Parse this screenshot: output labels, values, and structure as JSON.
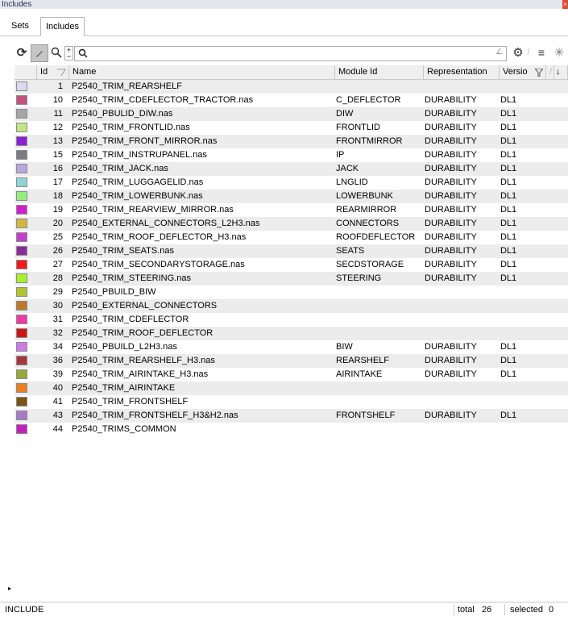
{
  "window": {
    "title": "Includes",
    "close_glyph": "×"
  },
  "tabs": [
    {
      "label": "Sets"
    },
    {
      "label": "Includes"
    }
  ],
  "toolbar": {
    "refresh_icon": "refresh-icon",
    "edit_icon": "pencil-icon",
    "zoom_icon": "zoom-icon",
    "search": {
      "value": "",
      "icon": "search-icon"
    },
    "settings_icon": "gear-icon",
    "menu_icon": "menu-icon",
    "filter_icon": "asterisk-icon"
  },
  "columns": {
    "id": "Id",
    "name": "Name",
    "module_id": "Module Id",
    "representation": "Representation",
    "version": "Versio"
  },
  "rows": [
    {
      "color": "#d9d9f2",
      "id": "1",
      "name": "P2540_TRIM_REARSHELF",
      "module": "",
      "rep": "",
      "ver": ""
    },
    {
      "color": "#c2547c",
      "id": "10",
      "name": "P2540_TRIM_CDEFLECTOR_TRACTOR.nas",
      "module": "C_DEFLECTOR",
      "rep": "DURABILITY",
      "ver": "DL1"
    },
    {
      "color": "#a5a5a5",
      "id": "11",
      "name": "P2540_PBULID_DIW.nas",
      "module": "DIW",
      "rep": "DURABILITY",
      "ver": "DL1"
    },
    {
      "color": "#c3e685",
      "id": "12",
      "name": "P2540_TRIM_FRONTLID.nas",
      "module": "FRONTLID",
      "rep": "DURABILITY",
      "ver": "DL1"
    },
    {
      "color": "#8a1fd6",
      "id": "13",
      "name": "P2540_TRIM_FRONT_MIRROR.nas",
      "module": "FRONTMIRROR",
      "rep": "DURABILITY",
      "ver": "DL1"
    },
    {
      "color": "#7b7b83",
      "id": "15",
      "name": "P2540_TRIM_INSTRUPANEL.nas",
      "module": "IP",
      "rep": "DURABILITY",
      "ver": "DL1"
    },
    {
      "color": "#b7a7dc",
      "id": "16",
      "name": "P2540_TRIM_JACK.nas",
      "module": "JACK",
      "rep": "DURABILITY",
      "ver": "DL1"
    },
    {
      "color": "#8fd4d6",
      "id": "17",
      "name": "P2540_TRIM_LUGGAGELID.nas",
      "module": "LNGLID",
      "rep": "DURABILITY",
      "ver": "DL1"
    },
    {
      "color": "#93ee7d",
      "id": "18",
      "name": "P2540_TRIM_LOWERBUNK.nas",
      "module": "LOWERBUNK",
      "rep": "DURABILITY",
      "ver": "DL1"
    },
    {
      "color": "#d11fcb",
      "id": "19",
      "name": "P2540_TRIM_REARVIEW_MIRROR.nas",
      "module": "REARMIRROR",
      "rep": "DURABILITY",
      "ver": "DL1"
    },
    {
      "color": "#d3b83f",
      "id": "20",
      "name": "P2540_EXTERNAL_CONNECTORS_L2H3.nas",
      "module": "CONNECTORS",
      "rep": "DURABILITY",
      "ver": "DL1"
    },
    {
      "color": "#c23fcf",
      "id": "25",
      "name": "P2540_TRIM_ROOF_DEFLECTOR_H3.nas",
      "module": "ROOFDEFLECTOR",
      "rep": "DURABILITY",
      "ver": "DL1"
    },
    {
      "color": "#8b2a9c",
      "id": "26",
      "name": "P2540_TRIM_SEATS.nas",
      "module": "SEATS",
      "rep": "DURABILITY",
      "ver": "DL1"
    },
    {
      "color": "#f01a1a",
      "id": "27",
      "name": "P2540_TRIM_SECONDARYSTORAGE.nas",
      "module": "SECDSTORAGE",
      "rep": "DURABILITY",
      "ver": "DL1"
    },
    {
      "color": "#a6f02c",
      "id": "28",
      "name": "P2540_TRIM_STEERING.nas",
      "module": "STEERING",
      "rep": "DURABILITY",
      "ver": "DL1"
    },
    {
      "color": "#b1c42f",
      "id": "29",
      "name": "P2540_PBUILD_BIW",
      "module": "",
      "rep": "",
      "ver": ""
    },
    {
      "color": "#bb7a2a",
      "id": "30",
      "name": "P2540_EXTERNAL_CONNECTORS",
      "module": "",
      "rep": "",
      "ver": ""
    },
    {
      "color": "#ee3aa7",
      "id": "31",
      "name": "P2540_TRIM_CDEFLECTOR",
      "module": "",
      "rep": "",
      "ver": ""
    },
    {
      "color": "#cf1414",
      "id": "32",
      "name": "P2540_TRIM_ROOF_DEFLECTOR",
      "module": "",
      "rep": "",
      "ver": ""
    },
    {
      "color": "#cf7ae8",
      "id": "34",
      "name": "P2540_PBUILD_L2H3.nas",
      "module": "BIW",
      "rep": "DURABILITY",
      "ver": "DL1"
    },
    {
      "color": "#a3373b",
      "id": "36",
      "name": "P2540_TRIM_REARSHELF_H3.nas",
      "module": "REARSHELF",
      "rep": "DURABILITY",
      "ver": "DL1"
    },
    {
      "color": "#98a83a",
      "id": "39",
      "name": "P2540_TRIM_AIRINTAKE_H3.nas",
      "module": "AIRINTAKE",
      "rep": "DURABILITY",
      "ver": "DL1"
    },
    {
      "color": "#e8801f",
      "id": "40",
      "name": "P2540_TRIM_AIRINTAKE",
      "module": "",
      "rep": "",
      "ver": ""
    },
    {
      "color": "#7a5316",
      "id": "41",
      "name": "P2540_TRIM_FRONTSHELF",
      "module": "",
      "rep": "",
      "ver": ""
    },
    {
      "color": "#a67ac8",
      "id": "43",
      "name": "P2540_TRIM_FRONTSHELF_H3&H2.nas",
      "module": "FRONTSHELF",
      "rep": "DURABILITY",
      "ver": "DL1"
    },
    {
      "color": "#c21fbd",
      "id": "44",
      "name": "P2540_TRIMS_COMMON",
      "module": "",
      "rep": "",
      "ver": ""
    }
  ],
  "status": {
    "type": "INCLUDE",
    "total_label": "total",
    "total_value": "26",
    "selected_label": "selected",
    "selected_value": "0"
  }
}
